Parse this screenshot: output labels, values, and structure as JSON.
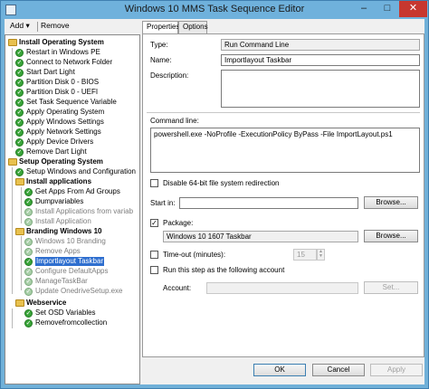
{
  "window": {
    "title": "Windows 10 MMS Task Sequence Editor",
    "minimize": "–",
    "maximize": "□",
    "close": "✕"
  },
  "toolbar": {
    "add_label": "Add ▾",
    "remove_label": "Remove"
  },
  "tree": {
    "items": [
      {
        "label": "Install Operating System"
      },
      {
        "label": "Restart in Windows PE"
      },
      {
        "label": "Connect to Network Folder"
      },
      {
        "label": "Start Dart Light"
      },
      {
        "label": "Partition Disk 0 - BIOS"
      },
      {
        "label": "Partition Disk 0 - UEFI"
      },
      {
        "label": "Set Task Sequence Variable"
      },
      {
        "label": "Apply Operating System"
      },
      {
        "label": "Apply Windows Settings"
      },
      {
        "label": "Apply Network Settings"
      },
      {
        "label": "Apply Device Drivers"
      },
      {
        "label": "Remove Dart Light"
      },
      {
        "label": "Setup Operating System"
      },
      {
        "label": "Setup Windows and Configuration"
      },
      {
        "label": "Install applications"
      },
      {
        "label": "Get Apps From Ad Groups"
      },
      {
        "label": "Dumpvariables"
      },
      {
        "label": "Install Applications from variab"
      },
      {
        "label": "Install Application"
      },
      {
        "label": "Branding Windows 10"
      },
      {
        "label": "Windows 10 Branding"
      },
      {
        "label": "Remove Apps"
      },
      {
        "label": "Importlayout Taskbar"
      },
      {
        "label": "Configure DefaultApps"
      },
      {
        "label": "ManageTaskBar"
      },
      {
        "label": "Update OnedriveSetup.exe"
      },
      {
        "label": "Webservice"
      },
      {
        "label": "Set OSD Variables"
      },
      {
        "label": "Removefromcollection"
      }
    ]
  },
  "tabs": {
    "properties": "Properties",
    "options": "Options"
  },
  "properties": {
    "type_label": "Type:",
    "type_value": "Run Command Line",
    "name_label": "Name:",
    "name_value": "Importlayout Taskbar",
    "description_label": "Description:",
    "description_value": "",
    "command_line_label": "Command line:",
    "command_line_value": "powershell.exe -NoProfile -ExecutionPolicy ByPass -File ImportLayout.ps1",
    "disable_redirection_label": "Disable 64-bit file system redirection",
    "start_in_label": "Start in:",
    "start_in_value": "",
    "browse_label": "Browse...",
    "package_label": "Package:",
    "package_value": "Windows 10 1607 Taskbar",
    "package_browse_label": "Browse...",
    "timeout_label": "Time-out (minutes):",
    "timeout_value": "15",
    "run_as_label": "Run this step as the following account",
    "account_label": "Account:",
    "account_value": "",
    "set_label": "Set...",
    "check_mark": "✓"
  },
  "footer": {
    "ok_label": "OK",
    "cancel_label": "Cancel",
    "apply_label": "Apply"
  }
}
